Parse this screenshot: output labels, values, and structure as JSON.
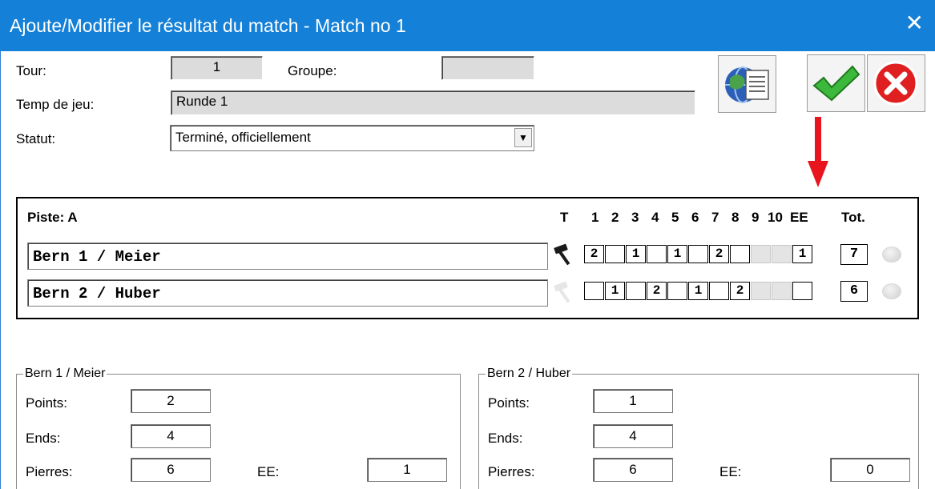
{
  "window": {
    "title": "Ajoute/Modifier le résultat du match - Match no 1",
    "close_glyph": "✕"
  },
  "form": {
    "tour_label": "Tour:",
    "tour_value": "1",
    "groupe_label": "Groupe:",
    "groupe_value": "",
    "temps_label": "Temp de jeu:",
    "temps_value": "Runde 1",
    "statut_label": "Statut:",
    "statut_value": "Terminé, officiellement"
  },
  "toolbar": {
    "report_icon": "globe-report-icon",
    "ok_icon": "checkmark-icon",
    "cancel_icon": "cancel-icon"
  },
  "piste": {
    "title": "Piste: A",
    "hammer_header": "T",
    "end_headers": [
      "1",
      "2",
      "3",
      "4",
      "5",
      "6",
      "7",
      "8",
      "9",
      "10",
      "EE"
    ],
    "total_header": "Tot.",
    "teams": [
      {
        "name": "Bern 1 / Meier",
        "hammer": true,
        "ends": [
          "2",
          "",
          "1",
          "",
          "1",
          "",
          "2",
          "",
          "",
          "",
          "1"
        ],
        "total": "7"
      },
      {
        "name": "Bern 2 / Huber",
        "hammer": false,
        "ends": [
          "",
          "1",
          "",
          "2",
          "",
          "1",
          "",
          "2",
          "",
          "",
          ""
        ],
        "total": "6"
      }
    ]
  },
  "team1": {
    "legend": "Bern 1 / Meier",
    "points_label": "Points:",
    "points": "2",
    "ends_label": "Ends:",
    "ends": "4",
    "pierres_label": "Pierres:",
    "pierres": "6",
    "ee_label": "EE:",
    "ee": "1"
  },
  "team2": {
    "legend": "Bern 2 / Huber",
    "points_label": "Points:",
    "points": "1",
    "ends_label": "Ends:",
    "ends": "4",
    "pierres_label": "Pierres:",
    "pierres": "6",
    "ee_label": "EE:",
    "ee": "0"
  },
  "colors": {
    "titlebar": "#1480d8",
    "ok_green": "#3cb83c",
    "cancel_red": "#e02020",
    "arrow_red": "#e8141e"
  }
}
